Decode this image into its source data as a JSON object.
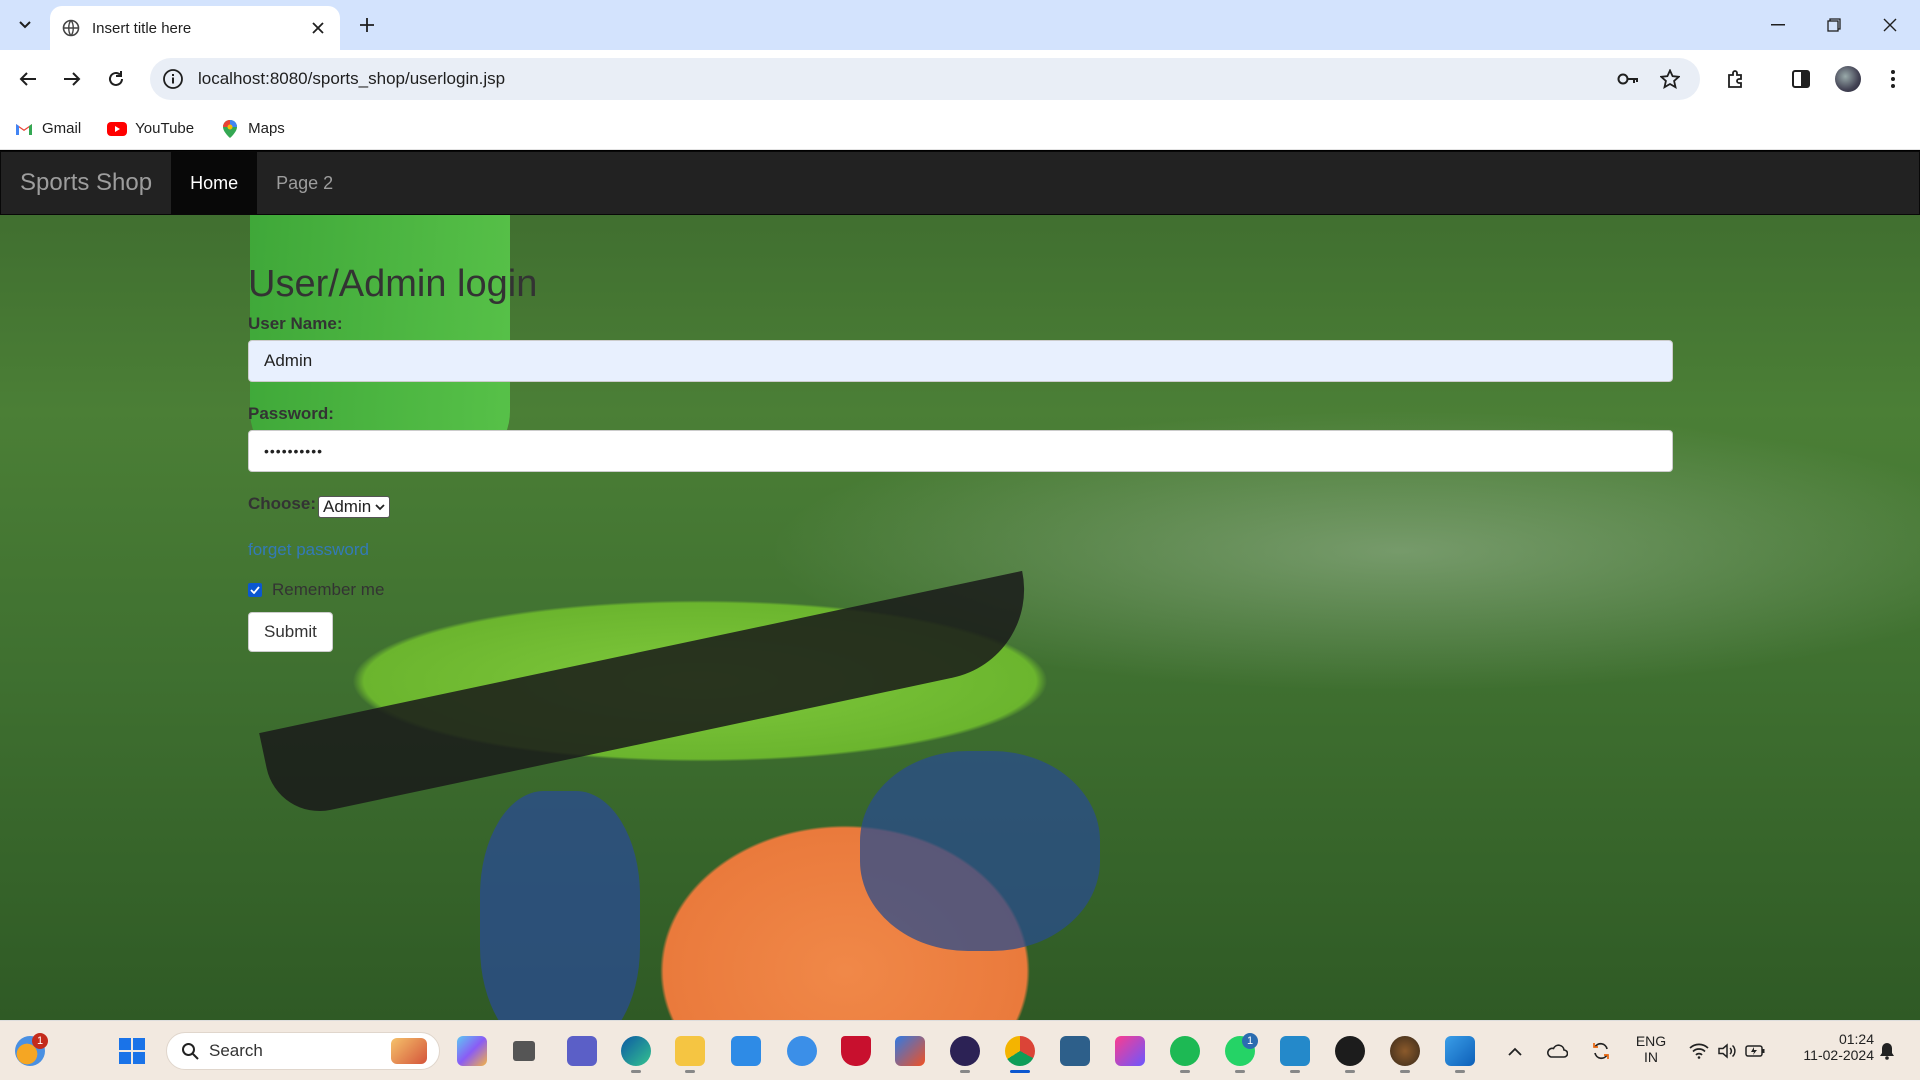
{
  "browser": {
    "tab_title": "Insert title here",
    "url": "localhost:8080/sports_shop/userlogin.jsp",
    "bookmarks": [
      {
        "label": "Gmail",
        "icon": "gmail-icon"
      },
      {
        "label": "YouTube",
        "icon": "youtube-icon"
      },
      {
        "label": "Maps",
        "icon": "maps-icon"
      }
    ]
  },
  "navbar": {
    "brand": "Sports Shop",
    "links": [
      {
        "label": "Home",
        "active": true
      },
      {
        "label": "Page 2",
        "active": false
      }
    ]
  },
  "login": {
    "heading": "User/Admin login",
    "username_label": "User Name:",
    "username_value": "Admin",
    "password_label": "Password:",
    "password_value": "••••••••••",
    "choose_label": "Choose:",
    "choose_selected": "Admin",
    "forget_link": "forget password",
    "remember_label": "Remember me",
    "remember_checked": true,
    "submit_label": "Submit"
  },
  "taskbar": {
    "search_placeholder": "Search",
    "weather_badge": "1",
    "whatsapp_badge": "1",
    "language_line1": "ENG",
    "language_line2": "IN",
    "time": "01:24",
    "date": "11-02-2024"
  },
  "colors": {
    "navbar_bg": "#222222",
    "link": "#337ab7",
    "checkbox": "#0b57d0"
  }
}
